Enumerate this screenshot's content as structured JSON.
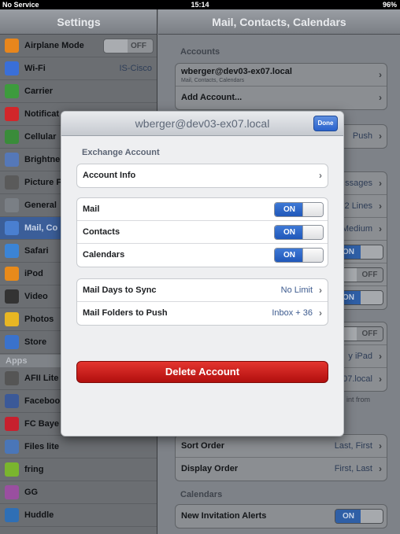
{
  "status_bar": {
    "carrier": "No Service",
    "time": "15:14",
    "battery": "96%"
  },
  "sidebar": {
    "title": "Settings",
    "items": [
      {
        "label": "Airplane Mode",
        "toggle": "OFF",
        "icon_color": "#e8861c"
      },
      {
        "label": "Wi-Fi",
        "value": "IS-Cisco",
        "icon_color": "#3a6fd8"
      },
      {
        "label": "Carrier",
        "icon_color": "#3d9b3d"
      },
      {
        "label": "Notificat",
        "icon_color": "#d2262a"
      },
      {
        "label": "Cellular",
        "icon_color": "#3a8c3a"
      },
      {
        "label": "Brightne",
        "icon_color": "#5578b8"
      },
      {
        "label": "Picture F",
        "icon_color": "#5a5a5a"
      },
      {
        "label": "General",
        "icon_color": "#7a7f85"
      },
      {
        "label": "Mail, Co",
        "icon_color": "#4a7fd0"
      },
      {
        "label": "Safari",
        "icon_color": "#3b84d6"
      },
      {
        "label": "iPod",
        "icon_color": "#e88a1a"
      },
      {
        "label": "Video",
        "icon_color": "#333333"
      },
      {
        "label": "Photos",
        "icon_color": "#e8b623"
      },
      {
        "label": "Store",
        "icon_color": "#3a72cc"
      }
    ],
    "apps_header": "Apps",
    "apps": [
      {
        "label": "AFII Lite",
        "icon_color": "#555555"
      },
      {
        "label": "Faceboo",
        "icon_color": "#3b5998"
      },
      {
        "label": "FC Baye",
        "icon_color": "#c7202e"
      },
      {
        "label": "Files lite",
        "icon_color": "#4a76b8"
      },
      {
        "label": "fring",
        "icon_color": "#7ab52e"
      },
      {
        "label": "GG",
        "icon_color": "#9a4fa0"
      },
      {
        "label": "Huddle",
        "icon_color": "#2f6fb5"
      }
    ]
  },
  "main": {
    "title": "Mail, Contacts, Calendars",
    "accounts_header": "Accounts",
    "account_email": "wberger@dev03-ex07.local",
    "account_sub": "Mail, Contacts, Calendars",
    "add_account": "Add Account...",
    "fetch_value": "Push",
    "messages_value": "ssages",
    "lines_value": "2 Lines",
    "medium_value": "Medium",
    "toggle_on": "ON",
    "toggle_off": "OFF",
    "ipad_value": "y iPad",
    "local_value": "07.local",
    "from_note": "int from",
    "sort_order": {
      "label": "Sort Order",
      "value": "Last, First"
    },
    "display_order": {
      "label": "Display Order",
      "value": "First, Last"
    },
    "calendars_header": "Calendars",
    "new_invitation": {
      "label": "New Invitation Alerts",
      "toggle": "ON"
    }
  },
  "modal": {
    "title": "wberger@dev03-ex07.local",
    "done": "Done",
    "section": "Exchange Account",
    "account_info": "Account Info",
    "toggles": [
      {
        "label": "Mail",
        "state": "ON"
      },
      {
        "label": "Contacts",
        "state": "ON"
      },
      {
        "label": "Calendars",
        "state": "ON"
      }
    ],
    "sync_days": {
      "label": "Mail Days to Sync",
      "value": "No Limit"
    },
    "push_folders": {
      "label": "Mail Folders to Push",
      "value": "Inbox + 36"
    },
    "delete": "Delete Account"
  }
}
